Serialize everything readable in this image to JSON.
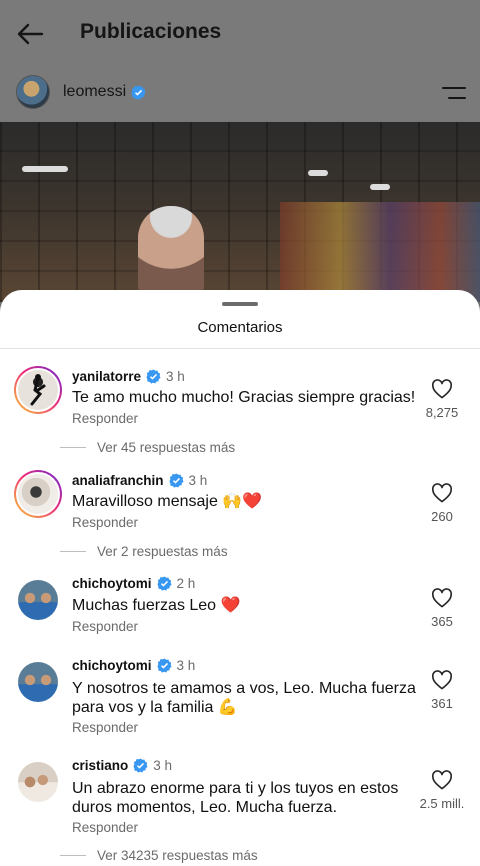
{
  "header": {
    "title": "Publicaciones",
    "back_icon": "arrow-left-icon",
    "menu_icon": "menu-icon"
  },
  "post": {
    "author": "leomessi",
    "verified": true
  },
  "sheet": {
    "title": "Comentarios"
  },
  "comments": [
    {
      "username": "yanilatorre",
      "time": "3 h",
      "text": "Te amo mucho mucho! Gracias siempre gracias!",
      "reply_label": "Responder",
      "likes": "8,275",
      "more_replies": "Ver 45 respuestas más"
    },
    {
      "username": "analiafranchin",
      "time": "3 h",
      "text": "Maravilloso mensaje 🙌❤️",
      "reply_label": "Responder",
      "likes": "260",
      "more_replies": "Ver 2 respuestas más"
    },
    {
      "username": "chichoytomi",
      "time": "2 h",
      "text": "Muchas fuerzas Leo ❤️",
      "reply_label": "Responder",
      "likes": "365"
    },
    {
      "username": "chichoytomi",
      "time": "3 h",
      "text": "Y nosotros te amamos a vos, Leo. Mucha fuerza para vos y la familia 💪",
      "reply_label": "Responder",
      "likes": "361"
    },
    {
      "username": "cristiano",
      "time": "3 h",
      "text": "Un abrazo enorme para ti y los tuyos en estos duros momentos, Leo. Mucha fuerza.",
      "reply_label": "Responder",
      "likes": "2.5 mill.",
      "more_replies": "Ver 34235 respuestas más"
    }
  ],
  "colors": {
    "verified": "#3897f0",
    "heart_red": "#ed4956",
    "muted_text": "#6b6b6b"
  }
}
